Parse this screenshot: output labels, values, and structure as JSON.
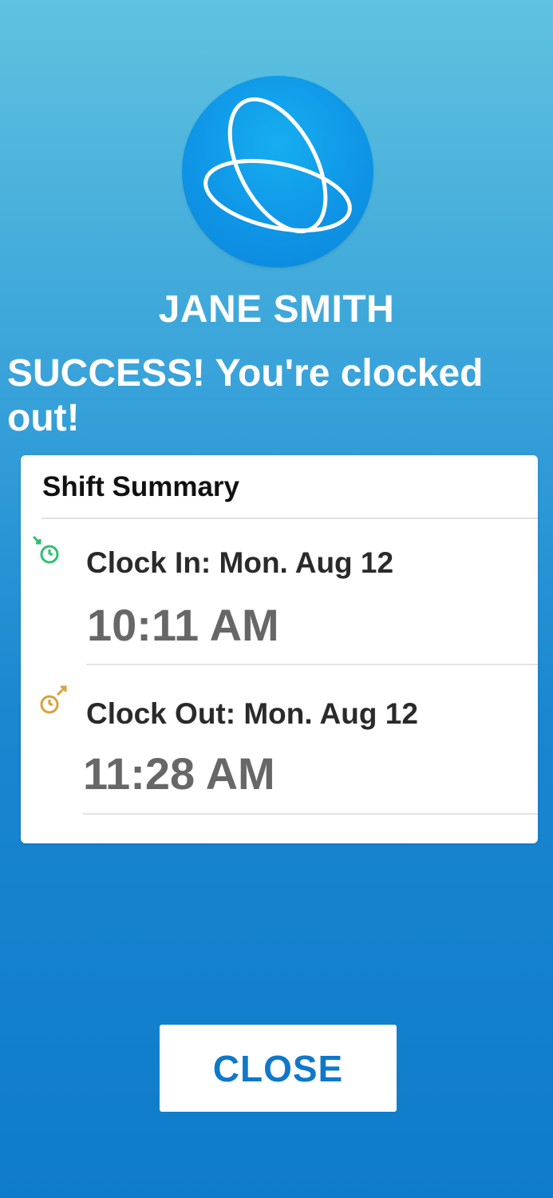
{
  "user": {
    "name": "JANE SMITH"
  },
  "status": {
    "message": "SUCCESS! You're clocked out!"
  },
  "shift_summary": {
    "title": "Shift Summary",
    "clock_in": {
      "label": "Clock In: Mon. Aug 12",
      "time": "10:11 AM",
      "icon": "clock-in-icon",
      "color": "#2fbf71"
    },
    "clock_out": {
      "label": "Clock Out: Mon. Aug 12",
      "time": "11:28 AM",
      "icon": "clock-out-icon",
      "color": "#d9a23a"
    }
  },
  "actions": {
    "close_label": "CLOSE"
  },
  "colors": {
    "accent": "#0f78c9",
    "logo": "#0f95e6"
  }
}
